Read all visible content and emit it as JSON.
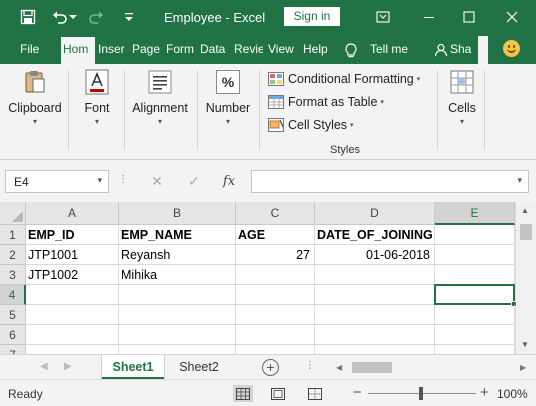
{
  "window": {
    "title": "Employee  -  Excel",
    "signin_label": "Sign in"
  },
  "ribbon_tabs": [
    "File",
    "Hom",
    "Inser",
    "Page",
    "Form",
    "Data",
    "Revie",
    "View",
    "Help",
    "Tell me",
    "Sha"
  ],
  "ribbon": {
    "clipboard": "Clipboard",
    "font": "Font",
    "alignment": "Alignment",
    "number": "Number",
    "number_glyph": "%",
    "conditional_formatting": "Conditional Formatting",
    "format_as_table": "Format as Table",
    "cell_styles": "Cell Styles",
    "styles_group": "Styles",
    "cells": "Cells"
  },
  "formula_bar": {
    "name_box": "E4",
    "cancel_glyph": "✕",
    "enter_glyph": "✓",
    "fx_glyph": "fx",
    "formula": ""
  },
  "grid": {
    "columns": [
      "A",
      "B",
      "C",
      "D",
      "E"
    ],
    "rows": [
      "1",
      "2",
      "3",
      "4",
      "5",
      "6",
      "7"
    ],
    "cells": [
      [
        "EMP_ID",
        "EMP_NAME",
        "AGE",
        "DATE_OF_JOINING",
        ""
      ],
      [
        "JTP1001",
        "Reyansh",
        "27",
        "01-06-2018",
        ""
      ],
      [
        "JTP1002",
        "Mihika",
        "",
        "",
        ""
      ],
      [
        "",
        "",
        "",
        "",
        ""
      ],
      [
        "",
        "",
        "",
        "",
        ""
      ],
      [
        "",
        "",
        "",
        "",
        ""
      ],
      [
        "",
        "",
        "",
        "",
        ""
      ]
    ],
    "active_cell": "E4"
  },
  "sheets": [
    "Sheet1",
    "Sheet2"
  ],
  "status": {
    "ready": "Ready",
    "zoom": "100%"
  },
  "colors": {
    "accent": "#217346",
    "ribbon_bg": "#f3f3f3"
  },
  "icons": [
    "save-icon",
    "undo-icon",
    "redo-icon",
    "customize-qat-icon",
    "restore-icon",
    "minimize-icon",
    "maximize-icon",
    "close-icon",
    "lightbulb-icon",
    "smiley-feedback-icon",
    "paste-icon",
    "font-icon",
    "alignment-icon",
    "number-icon",
    "conditional-formatting-icon",
    "format-table-icon",
    "cell-styles-icon",
    "cells-icon",
    "normal-view-icon",
    "page-layout-view-icon",
    "page-break-view-icon"
  ]
}
